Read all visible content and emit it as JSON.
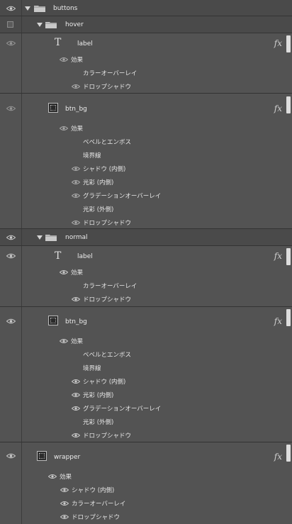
{
  "layers": {
    "buttons": {
      "name": "buttons"
    },
    "hover": {
      "name": "hover",
      "label": {
        "name": "label",
        "effects_title": "効果",
        "effects": [
          "カラーオーバーレイ",
          "ドロップシャドウ"
        ]
      },
      "btn_bg": {
        "name": "btn_bg",
        "effects_title": "効果",
        "effects": [
          "ベベルとエンボス",
          "境界線",
          "シャドウ (内側)",
          "光彩 (内側)",
          "グラデーションオーバーレイ",
          "光彩 (外側)",
          "ドロップシャドウ"
        ]
      }
    },
    "normal": {
      "name": "normal",
      "label": {
        "name": "label",
        "effects_title": "効果",
        "effects": [
          "カラーオーバーレイ",
          "ドロップシャドウ"
        ]
      },
      "btn_bg": {
        "name": "btn_bg",
        "effects_title": "効果",
        "effects": [
          "ベベルとエンボス",
          "境界線",
          "シャドウ (内側)",
          "光彩 (内側)",
          "グラデーションオーバーレイ",
          "光彩 (外側)",
          "ドロップシャドウ"
        ]
      }
    },
    "wrapper": {
      "name": "wrapper",
      "effects_title": "効果",
      "effects": [
        "シャドウ (内側)",
        "カラーオーバーレイ",
        "ドロップシャドウ"
      ]
    }
  },
  "fx_label": "fx",
  "icons": {
    "visibility": "eye-icon",
    "expand": "disclosure-triangle-icon",
    "folder": "folder-icon",
    "text_layer": "text-layer-icon",
    "thumbnail": "layer-thumbnail-icon",
    "effects": "fx-icon"
  }
}
